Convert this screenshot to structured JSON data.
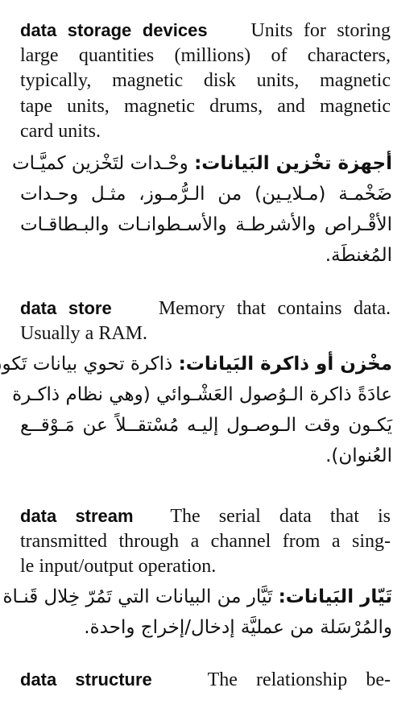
{
  "entries": [
    {
      "term": "data storage devices",
      "definition_lines": [
        "Units for storing",
        "large quantities (millions) of characters,",
        "typically, magnetic disk units, magnetic",
        "tape units, magnetic drums, and magnetic",
        "card units."
      ],
      "arabic_term": "أجهزة تخْزين البَيانات:",
      "arabic_lines": [
        "وحْـدات لتَخْزين كميَّـات",
        "ضَخْمـة (مـلايـين) من الـرُّمـوز، مثـل وحـدات",
        "الأقْـراص والأشرطـة والأسـطوانـات والبـطاقـات",
        "المُغنطَة."
      ]
    },
    {
      "term": "data store",
      "definition_lines": [
        "Memory that contains data.",
        "Usually a RAM."
      ],
      "arabic_term": "مخْزن أو ذاكرة البَيانات:",
      "arabic_lines": [
        "ذاكرة تحوي بيانات تَكون",
        "عادَةً ذاكرة الـوُصول العَشْـوائي (وهي نظام ذاكـرة",
        "يَكـون وقت الـوصـول إليـه مُسْتقــلاً عن مَـوْقــع",
        "العُنوان)."
      ]
    },
    {
      "term": "data stream",
      "definition_lines": [
        "The serial data that is",
        "transmitted through a channel from a sing-",
        "le input/output operation."
      ],
      "arabic_term": "تَيّار البَيانات:",
      "arabic_lines": [
        "تَيَّار من البيانات التي تَمُرّ خِلال قَنـاة",
        "والمُرْسَلة من عمليَّة إدخال/إخراج واحدة."
      ]
    },
    {
      "term": "data structure",
      "definition_lines": [
        "The relationship be-"
      ]
    }
  ]
}
